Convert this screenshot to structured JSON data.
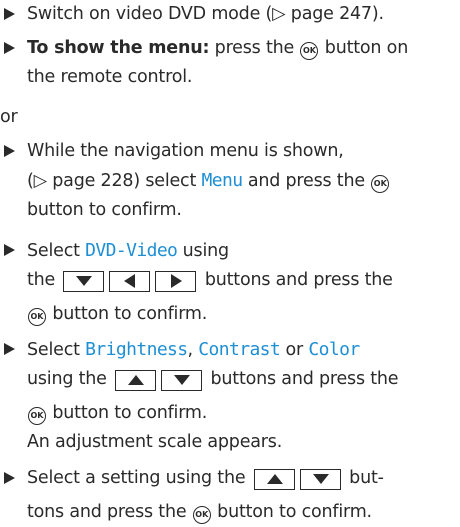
{
  "page_ref": "247",
  "page_ref_2": "228",
  "ok_label": "OK",
  "s1": {
    "text_a": "Switch on video DVD mode (",
    "arrow": "▷",
    "page_word": " page ",
    "text_b": ")."
  },
  "s2": {
    "bold": "To show the menu:",
    "text_a": " press the ",
    "text_b": " button on",
    "line2": "the remote control."
  },
  "or_text": "or",
  "s3": {
    "line1": "While the navigation menu is shown,",
    "paren_open": "(",
    "arrow": "▷",
    "page_word": " page ",
    "paren_close": ") select ",
    "menu_word": "Menu",
    "text_b": " and press the ",
    "line3": "button to confirm."
  },
  "s4": {
    "text_a": "Select ",
    "code": "DVD-Video",
    "text_b": " using",
    "line2_a": "the ",
    "line2_b": " buttons and press the",
    "line3": " button to confirm."
  },
  "s5": {
    "text_a": "Select ",
    "code1": "Brightness",
    "comma": ", ",
    "code2": "Contrast",
    "or": " or ",
    "code3": "Color",
    "line2_a": "using the ",
    "line2_b": " buttons and press the",
    "line3": " button to confirm.",
    "line4": "An adjustment scale appears."
  },
  "s6": {
    "text_a": "Select a setting using the ",
    "text_b": " but-",
    "line2_a": "tons and press the ",
    "line2_b": " button to confirm."
  },
  "icons": {
    "bullet": "triangle-bullet-icon",
    "ok": "ok-button-icon",
    "up": "arrow-up-button-icon",
    "down": "arrow-down-button-icon",
    "left": "arrow-left-button-icon",
    "right": "arrow-right-button-icon"
  },
  "colors": {
    "text": "#2a2a2a",
    "highlight": "#1e8fd4"
  }
}
